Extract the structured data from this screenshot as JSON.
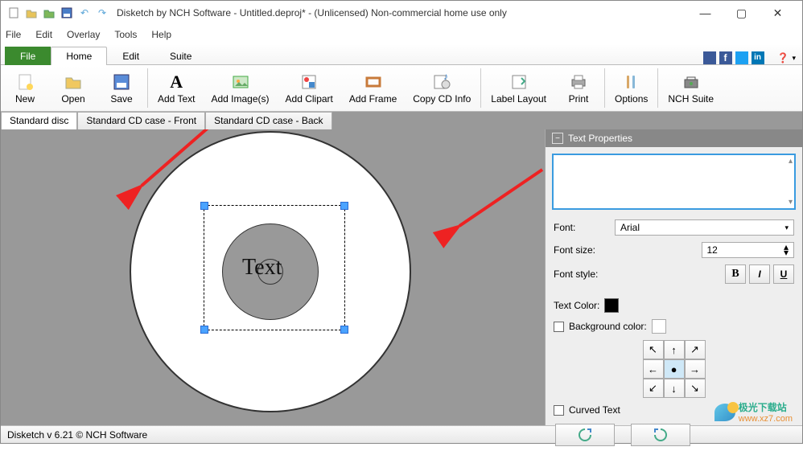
{
  "window": {
    "title": "Disketch by NCH Software - Untitled.deproj* - (Unlicensed) Non-commercial home use only"
  },
  "menu": {
    "file": "File",
    "edit": "Edit",
    "overlay": "Overlay",
    "tools": "Tools",
    "help": "Help"
  },
  "tabs": {
    "file": "File",
    "home": "Home",
    "edit": "Edit",
    "suite": "Suite"
  },
  "toolbar": {
    "new": "New",
    "open": "Open",
    "save": "Save",
    "add_text": "Add Text",
    "add_images": "Add Image(s)",
    "add_clipart": "Add Clipart",
    "add_frame": "Add Frame",
    "copy_cd_info": "Copy CD Info",
    "label_layout": "Label Layout",
    "print": "Print",
    "options": "Options",
    "nch_suite": "NCH Suite"
  },
  "doctabs": {
    "standard_disc": "Standard disc",
    "cd_case_front": "Standard CD case - Front",
    "cd_case_back": "Standard CD case - Back"
  },
  "canvas": {
    "placeholder_text": "Text"
  },
  "props": {
    "title": "Text Properties",
    "font_label": "Font:",
    "font_value": "Arial",
    "font_size_label": "Font size:",
    "font_size_value": "12",
    "font_style_label": "Font style:",
    "text_color_label": "Text Color:",
    "bg_color_label": "Background color:",
    "curved_text": "Curved Text",
    "bold": "B",
    "italic": "I",
    "underline": "U",
    "text_content": ""
  },
  "status": {
    "left": "Disketch v 6.21 © NCH Software"
  },
  "watermark": {
    "line1": "极光下载站",
    "line2": "www.xz7.com"
  }
}
